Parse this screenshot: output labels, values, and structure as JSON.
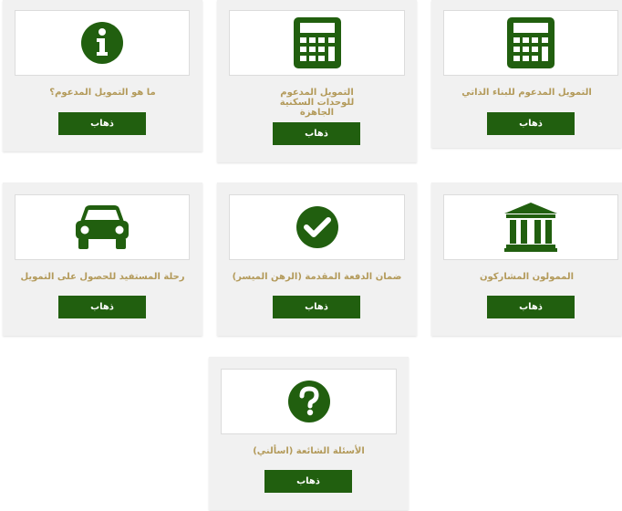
{
  "colors": {
    "accent": "#215f0f",
    "title_text": "#b39a5a",
    "card_bg": "#f1f1f1"
  },
  "cards": [
    {
      "title": "التمويل المدعوم للبناء الذاتي",
      "button": "ذهاب",
      "icon": "calculator-icon"
    },
    {
      "title": "التمويل المدعوم للوحدات السكنية الجاهزة",
      "button": "ذهاب",
      "icon": "calculator-icon"
    },
    {
      "title": "ما هو التمويل المدعوم؟",
      "button": "ذهاب",
      "icon": "info-icon"
    },
    {
      "title": "الممولون المشاركون",
      "button": "ذهاب",
      "icon": "bank-icon"
    },
    {
      "title": "ضمان الدفعة المقدمة (الرهن الميسر)",
      "button": "ذهاب",
      "icon": "checkmark-icon"
    },
    {
      "title": "رحلة المستفيد للحصول على التمويل",
      "button": "ذهاب",
      "icon": "car-icon"
    },
    {
      "title": "الأسئلة الشائعة (اسألني)",
      "button": "ذهاب",
      "icon": "question-icon"
    }
  ]
}
